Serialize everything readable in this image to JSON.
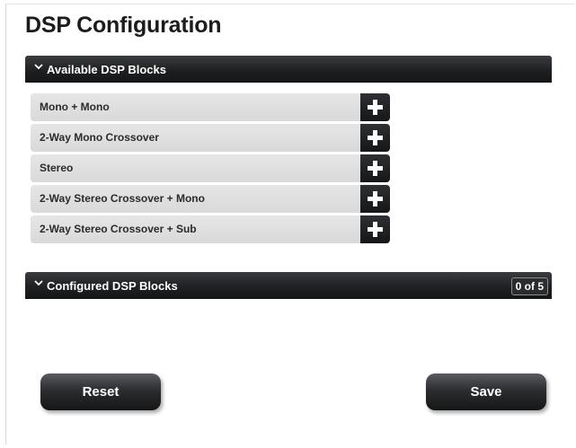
{
  "page": {
    "title": "DSP Configuration"
  },
  "available": {
    "header_label": "Available DSP Blocks",
    "items": [
      {
        "label": "Mono + Mono"
      },
      {
        "label": "2-Way Mono Crossover"
      },
      {
        "label": "Stereo"
      },
      {
        "label": "2-Way Stereo Crossover + Mono"
      },
      {
        "label": "2-Way Stereo Crossover + Sub"
      }
    ]
  },
  "configured": {
    "header_label": "Configured DSP Blocks",
    "count": "0 of 5"
  },
  "actions": {
    "reset_label": "Reset",
    "save_label": "Save"
  },
  "icons": {
    "expand": "chevron-down-icon",
    "add": "plus-icon"
  },
  "colors": {
    "header_bg": "#1e2022",
    "item_bg": "#dcdcdc",
    "button_bg": "#2b2d2f"
  }
}
